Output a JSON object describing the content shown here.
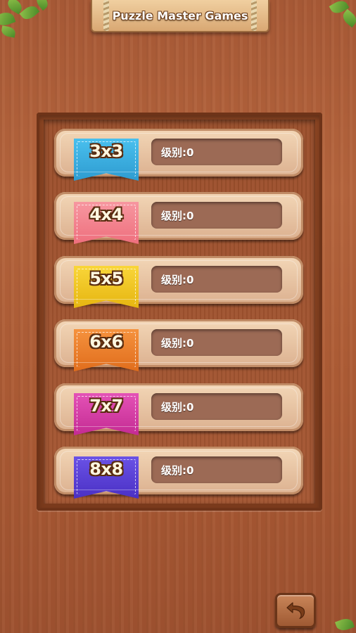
{
  "header": {
    "title": "Puzzle Master Games"
  },
  "levels": [
    {
      "size": "3x3",
      "status": "级别:0",
      "color": "#3ab0df"
    },
    {
      "size": "4x4",
      "status": "级别:0",
      "color": "#f4848f"
    },
    {
      "size": "5x5",
      "status": "级别:0",
      "color": "#f2c518"
    },
    {
      "size": "6x6",
      "status": "级别:0",
      "color": "#ef7f28"
    },
    {
      "size": "7x7",
      "status": "级别:0",
      "color": "#d83aa6"
    },
    {
      "size": "8x8",
      "status": "级别:0",
      "color": "#5a3fd6"
    }
  ],
  "footer": {
    "back_icon": "undo-arrow-icon"
  }
}
